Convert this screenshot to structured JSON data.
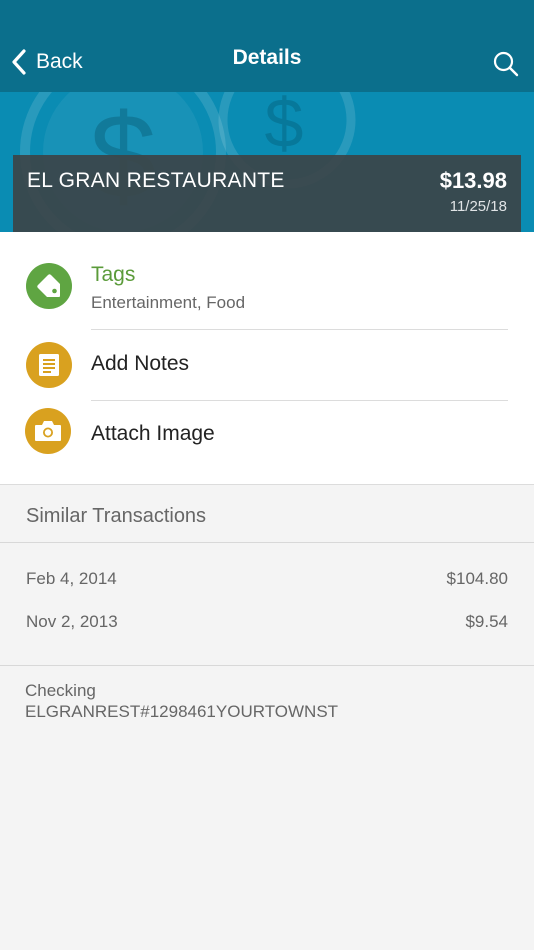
{
  "header": {
    "back_label": "Back",
    "title": "Details"
  },
  "transaction": {
    "merchant": "EL GRAN RESTAURANTE",
    "amount": "$13.98",
    "date": "11/25/18"
  },
  "actions": {
    "tags": {
      "label": "Tags",
      "value": "Entertainment, Food"
    },
    "notes": {
      "label": "Add Notes"
    },
    "image": {
      "label": "Attach Image"
    }
  },
  "similar": {
    "title": "Similar Transactions",
    "rows": [
      {
        "date": "Feb 4, 2014",
        "amount": "$104.80"
      },
      {
        "date": "Nov 2, 2013",
        "amount": "$9.54"
      }
    ]
  },
  "account": {
    "type": "Checking",
    "description": "ELGRANREST#1298461YOURTOWNST"
  },
  "colors": {
    "header": "#0b6f8c",
    "hero": "#0a8cb3",
    "tag_green": "#5fa542",
    "icon_gold": "#d9a11f"
  },
  "icons": [
    "chevron-left-icon",
    "search-icon",
    "dollar-coin-icon",
    "tag-icon",
    "notes-icon",
    "camera-icon"
  ]
}
